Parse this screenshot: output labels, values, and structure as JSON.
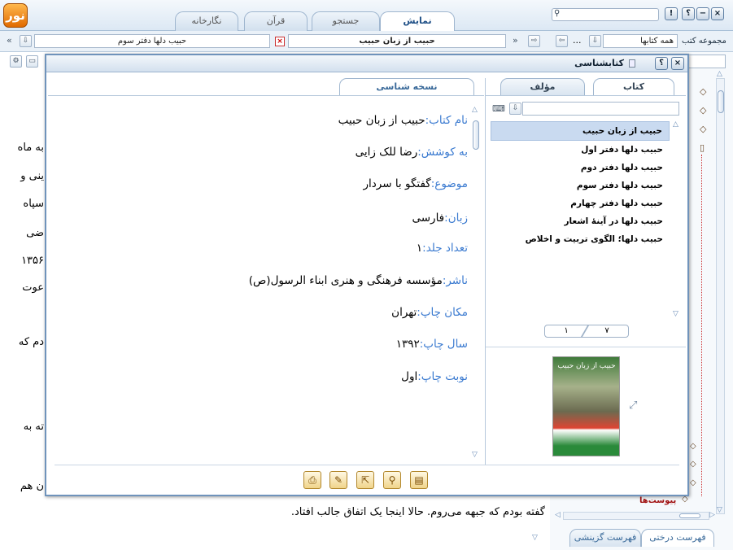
{
  "app": {
    "logo_text": "نور"
  },
  "top_tabs": [
    {
      "label": "نمایش",
      "active": true
    },
    {
      "label": "جستجو",
      "active": false
    },
    {
      "label": "قرآن",
      "active": false
    },
    {
      "label": "نگارخانه",
      "active": false
    }
  ],
  "window_buttons": {
    "close": "×",
    "minimize": "−",
    "help": "؟",
    "alert": "!"
  },
  "search": {
    "icon": "search-icon"
  },
  "navbar": {
    "current_book": "حبیب از زبان حبیب",
    "previous_book": "حبیب دلها دفتر سوم",
    "collection_label": "مجموعه کتب",
    "collection_value": "همه کتابها",
    "ellipsis": "..."
  },
  "reader": {
    "left_fragments": [
      "به ماه",
      "ینی و",
      "سپاه",
      "ضی",
      "۱۳۵۶",
      "عوت",
      "دم که",
      "ته به",
      "ن هم"
    ],
    "bottom_line": "گفته بودم که جبهه می‌روم. حالا اینجا یک اتفاق جالب افتاد."
  },
  "right_panel": {
    "attachments_label": "پیوست‌ها",
    "tabs": [
      "فهرست درختی",
      "فهرست گزینشی"
    ]
  },
  "dialog": {
    "title": "کتابشناسی",
    "left_tabs": [
      {
        "label": "کتاب",
        "active": true
      },
      {
        "label": "مؤلف",
        "active": false
      }
    ],
    "right_tab": "نسخه شناسی",
    "fields": [
      {
        "label": "نام کتاب:",
        "value": "حبیب از زبان حبیب"
      },
      {
        "label": "به کوشش:",
        "value": "رضا للک زایی"
      },
      {
        "label": "موضوع:",
        "value": "گفتگو با سردار"
      },
      {
        "label": "زبان:",
        "value": "فارسی"
      },
      {
        "label": "تعداد جلد:",
        "value": "۱"
      },
      {
        "label": "ناشر:",
        "value": "مؤسسه فرهنگی و هنری ابناء الرسول(ص)"
      },
      {
        "label": "مکان چاپ:",
        "value": "تهران"
      },
      {
        "label": "سال چاپ:",
        "value": "۱۳۹۲"
      },
      {
        "label": "نوبت چاپ:",
        "value": "اول"
      }
    ],
    "book_list": [
      "حبیب از زبان حبیب",
      "حبیب دلها دفتر اول",
      "حبیب دلها دفتر دوم",
      "حبیب دلها دفتر سوم",
      "حبیب دلها دفتر چهارم",
      "حبیب دلها در آینهٔ اشعار",
      "حبیب دلها؛ الگوی تربیت و اخلاص"
    ],
    "pager": {
      "current": "۱",
      "total": "۷"
    },
    "cover_title": "حبیب از زبان حبیب",
    "bottom_buttons": [
      "print-icon",
      "edit-icon",
      "export-icon",
      "magnifier-icon",
      "note-icon"
    ]
  },
  "colors": {
    "accent": "#3a7ad0",
    "selection": "#c9daf0",
    "frame": "#6f93bb"
  }
}
